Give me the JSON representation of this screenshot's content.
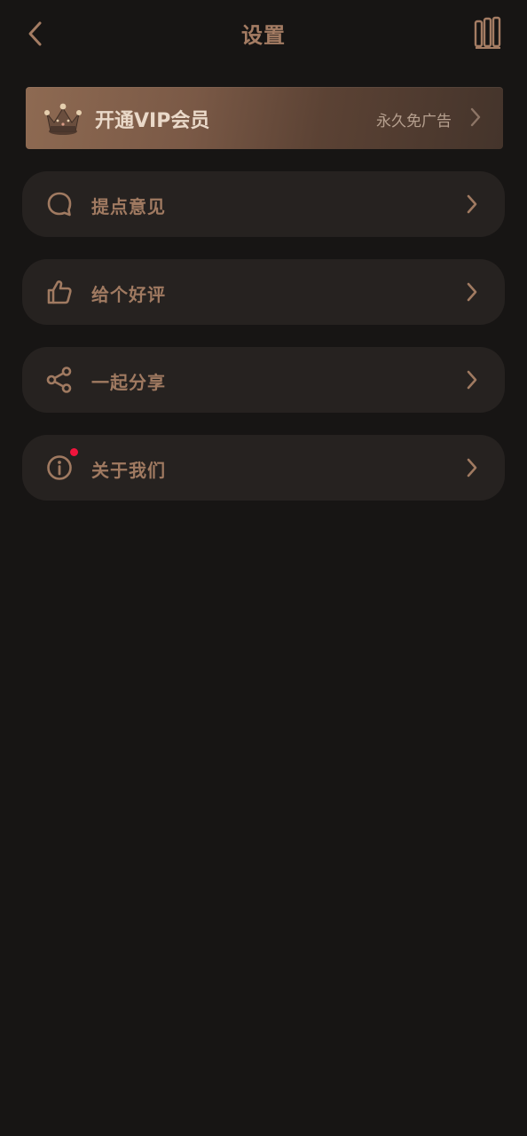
{
  "header": {
    "title": "设置",
    "back_icon": "chevron-left-icon",
    "right_icon": "library-icon"
  },
  "vip": {
    "title": "开通VIP会员",
    "subtitle": "永久免广告",
    "icon": "crown-icon"
  },
  "menu": [
    {
      "label": "提点意见",
      "icon": "comment-icon"
    },
    {
      "label": "给个好评",
      "icon": "thumbs-up-icon"
    },
    {
      "label": "一起分享",
      "icon": "share-icon"
    },
    {
      "label": "关于我们",
      "icon": "info-icon",
      "has_badge": true
    }
  ],
  "colors": {
    "background": "#171514",
    "card": "#262220",
    "accent": "#a07a61",
    "badge": "#f0143c"
  }
}
